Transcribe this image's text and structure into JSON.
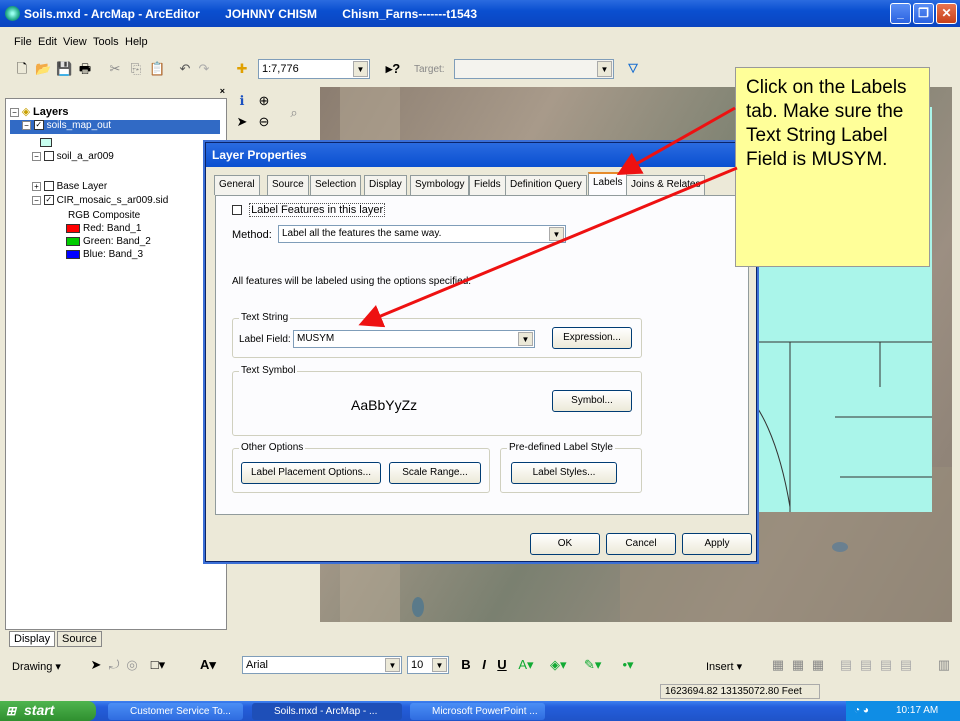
{
  "window": {
    "title": "Soils.mxd - ArcMap - ArcEditor",
    "user": "JOHNNY CHISM",
    "project": "Chism_Farns-------t1543"
  },
  "menu": [
    "File",
    "Edit",
    "View",
    "Tools",
    "Help"
  ],
  "toolbar": {
    "scale": "1:7,776",
    "target_label": "Target:"
  },
  "toc": {
    "root": "Layers",
    "items": [
      {
        "label": "soils_map_out",
        "checked": true,
        "selected": true
      },
      {
        "label": "soil_a_ar009",
        "checked": false
      },
      {
        "label": "Base Layer",
        "checked": false
      },
      {
        "label": "CIR_mosaic_s_ar009.sid",
        "checked": true
      }
    ],
    "rgb_label": "RGB Composite",
    "bands": [
      {
        "label": "Red:   Band_1",
        "color": "#ff0000"
      },
      {
        "label": "Green: Band_2",
        "color": "#00cc00"
      },
      {
        "label": "Blue:  Band_3",
        "color": "#0000ff"
      }
    ],
    "tabs": [
      "Display",
      "Source"
    ]
  },
  "dialog": {
    "title": "Layer Properties",
    "help": "?",
    "tabs": [
      "General",
      "Source",
      "Selection",
      "Display",
      "Symbology",
      "Fields",
      "Definition Query",
      "Labels",
      "Joins & Relates"
    ],
    "active_tab": "Labels",
    "label_features": "Label Features in this layer",
    "method_label": "Method:",
    "method_value": "Label all the features the same way.",
    "info_text": "All features will be labeled using the options specified.",
    "text_string_group": "Text String",
    "label_field_label": "Label Field:",
    "label_field_value": "MUSYM",
    "expression_button": "Expression...",
    "text_symbol_group": "Text Symbol",
    "symbol_preview": "AaBbYyZz",
    "symbol_button": "Symbol...",
    "other_options_group": "Other Options",
    "placement_button": "Label Placement Options...",
    "scale_range_button": "Scale Range...",
    "predefined_group": "Pre-defined Label Style",
    "label_styles_button": "Label Styles...",
    "ok": "OK",
    "cancel": "Cancel",
    "apply": "Apply"
  },
  "callout": {
    "text": "Click on the Labels tab. Make sure the Text String Label Field is MUSYM."
  },
  "drawing_toolbar": {
    "drawing": "Drawing",
    "font": "Arial",
    "size": "10",
    "insert": "Insert"
  },
  "status": {
    "coordinates": "1623694.82  13135072.80 Feet"
  },
  "taskbar": {
    "start": "start",
    "tasks": [
      "Customer Service To...",
      "Soils.mxd - ArcMap - ...",
      "Microsoft PowerPoint ..."
    ],
    "clock": "10:17 AM"
  }
}
